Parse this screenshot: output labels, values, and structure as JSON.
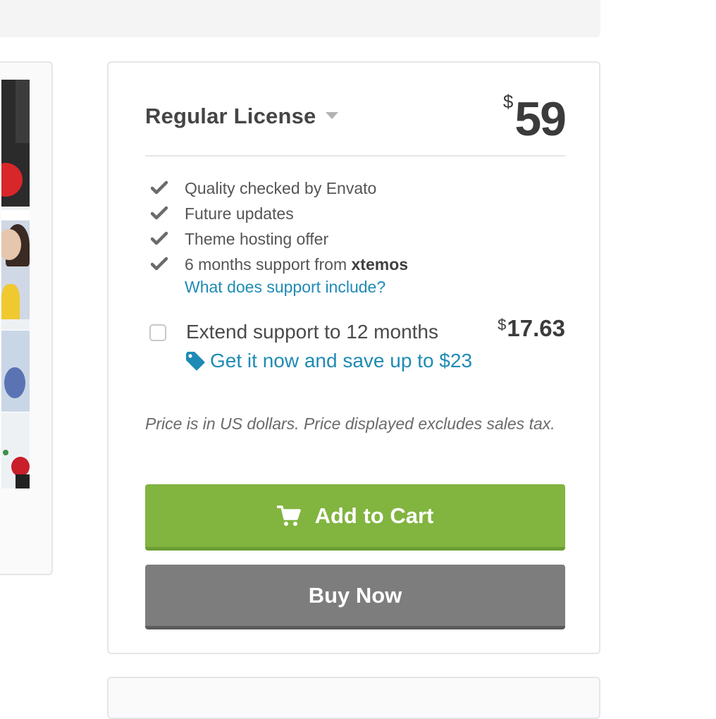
{
  "license": {
    "title": "Regular License",
    "currency_symbol": "$",
    "price": "59"
  },
  "features": [
    {
      "text": "Quality checked by Envato",
      "bold": ""
    },
    {
      "text": "Future updates",
      "bold": ""
    },
    {
      "text": "Theme hosting offer",
      "bold": ""
    },
    {
      "text": "6 months support from ",
      "bold": "xtemos"
    }
  ],
  "support_link": "What does support include?",
  "extend": {
    "label": "Extend support to 12 months",
    "currency_symbol": "$",
    "price": "17.63",
    "save_text": "Get it now and save up to $23"
  },
  "tax_note": "Price is in US dollars. Price displayed excludes sales tax.",
  "buttons": {
    "add_to_cart": "Add to Cart",
    "buy_now": "Buy Now"
  },
  "colors": {
    "accent_green": "#82b440",
    "button_gray": "#7d7d7d",
    "link_blue": "#1f8bb4"
  },
  "icons": [
    "caret-down-icon",
    "check-icon",
    "tag-icon",
    "cart-icon"
  ]
}
